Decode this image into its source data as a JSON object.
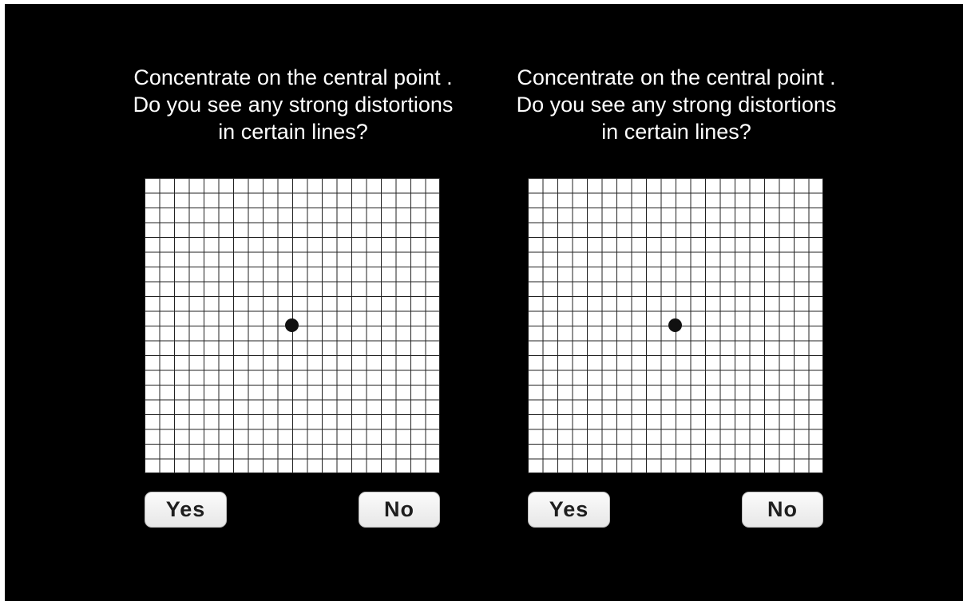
{
  "panels": [
    {
      "instruction": {
        "line1": "Concentrate on the central point .",
        "line2": "Do you see any strong distortions",
        "line3": "in certain lines?"
      },
      "yes_label": "Yes",
      "no_label": "No"
    },
    {
      "instruction": {
        "line1": "Concentrate on the central point .",
        "line2": "Do you see any strong distortions",
        "line3": "in certain lines?"
      },
      "yes_label": "Yes",
      "no_label": "No"
    }
  ],
  "colors": {
    "background": "#000000",
    "text": "#ffffff",
    "grid_lines": "#222222",
    "grid_background": "#ffffff",
    "button_background": "#f2f2f2",
    "button_text": "#1e1e1e"
  }
}
